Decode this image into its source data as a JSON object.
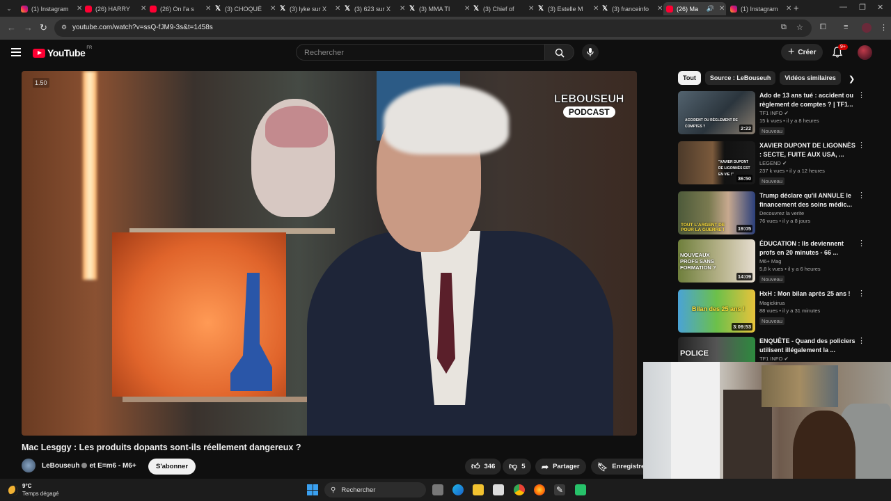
{
  "browser": {
    "tabs": [
      {
        "label": "(1) Instagram",
        "favicon": "instagram-icon"
      },
      {
        "label": "(26) HARRY",
        "favicon": "youtube-icon"
      },
      {
        "label": "(26) On l'a s",
        "favicon": "youtube-icon"
      },
      {
        "label": "(3) CHOQUÉ",
        "favicon": "x-icon"
      },
      {
        "label": "(3) lyke sur X",
        "favicon": "x-icon"
      },
      {
        "label": "(3) 623 sur X",
        "favicon": "x-icon"
      },
      {
        "label": "(3) MMA TI",
        "favicon": "x-icon"
      },
      {
        "label": "(3) Chief of",
        "favicon": "x-icon"
      },
      {
        "label": "(3) Estelle M",
        "favicon": "x-icon"
      },
      {
        "label": "(3) franceinfo",
        "favicon": "x-icon"
      },
      {
        "label": "(26) Ma",
        "favicon": "youtube-icon",
        "active": true
      },
      {
        "label": "(1) Instagram",
        "favicon": "instagram-icon"
      }
    ],
    "url": "youtube.com/watch?v=ssQ-fJM9-3s&t=1458s"
  },
  "youtube": {
    "logo_text": "YouTube",
    "country_code": "FR",
    "search_placeholder": "Rechercher",
    "create_label": "Créer",
    "notifications_badge": "9+"
  },
  "video": {
    "speed_label": "1.50",
    "overlay_logo_line1": "LEBOUSEUH",
    "overlay_logo_line2": "PODCAST",
    "title": "Mac Lesggy : Les produits dopants sont-ils réellement dangereux ?",
    "channel": "LeBouseuh",
    "collab": "et E=m6 - M6+",
    "subscribe_label": "S'abonner",
    "likes": "346",
    "dislikes": "5",
    "share_label": "Partager",
    "save_label": "Enregistrer"
  },
  "sidebar": {
    "chips": [
      "Tout",
      "Source : LeBouseuh",
      "Vidéos similaires"
    ],
    "recommendations": [
      {
        "title": "Ado de 13 ans tué : accident ou règlement de comptes ? | TF1...",
        "channel": "TF1 INFO",
        "verified": true,
        "meta": "15 k vues • il y a 8 heures",
        "badge": "Nouveau",
        "duration": "2:22",
        "thumb_text": "ACCIDENT OU RÈGLEMENT DE COMPTES ?"
      },
      {
        "title": "XAVIER DUPONT DE LIGONNÈS : SECTE, FUITE AUX USA, ...",
        "channel": "LEGEND",
        "verified": true,
        "meta": "237 k vues • il y a 12 heures",
        "badge": "Nouveau",
        "duration": "36:50",
        "thumb_text": "\"XAVIER DUPONT DE LIGONNÈS EST EN VIE !\""
      },
      {
        "title": "Trump déclare qu'il ANNULE le financement des soins médic...",
        "channel": "Decouvrez la verite",
        "verified": false,
        "meta": "76 vues • il y a 8 jours",
        "badge": "",
        "duration": "19:05",
        "thumb_text": "TOUT L'ARGENT DE POUR LA GUERRE !"
      },
      {
        "title": "ÉDUCATION : Ils deviennent profs en 20 minutes - 66 ...",
        "channel": "M6+ Mag",
        "verified": false,
        "meta": "5,8 k vues • il y a 6 heures",
        "badge": "Nouveau",
        "duration": "14:09",
        "thumb_text": "NOUVEAUX PROFS SANS FORMATION ?"
      },
      {
        "title": "HxH : Mon bilan après 25 ans !",
        "channel": "Magickirua",
        "verified": false,
        "meta": "88 vues • il y a 31 minutes",
        "badge": "Nouveau",
        "duration": "3:09:53",
        "thumb_text": "Bilan des 25 ans !"
      },
      {
        "title": "ENQUÊTE - Quand des policiers utilisent illégalement la ...",
        "channel": "TF1 INFO",
        "verified": true,
        "meta": "",
        "badge": "",
        "duration": "",
        "thumb_text": "POLICE"
      }
    ]
  },
  "taskbar": {
    "temperature": "9°C",
    "condition": "Temps dégagé",
    "search_label": "Rechercher",
    "pinned": [
      "task-view-icon",
      "edge-icon",
      "file-explorer-icon",
      "store-icon",
      "chrome-icon",
      "firefox-icon",
      "app-icon",
      "app-icon-green"
    ]
  }
}
